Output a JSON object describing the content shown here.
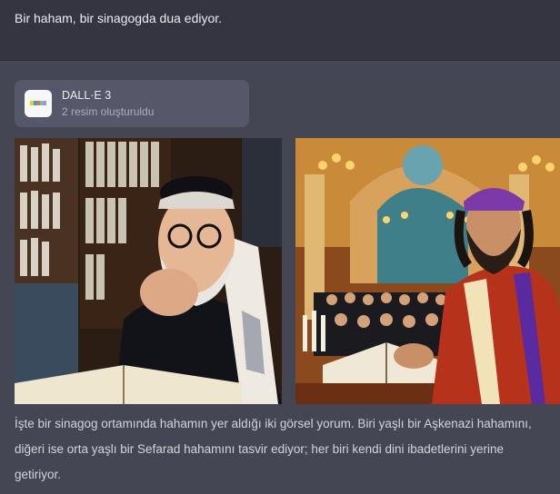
{
  "user_message": "Bir haham, bir sinagogda dua ediyor.",
  "dalle": {
    "title": "DALL·E 3",
    "subtitle": "2 resim oluşturuldu",
    "logo_colors": [
      "#ffcc00",
      "#00b2ff",
      "#ff5c5c",
      "#4ade80",
      "#a78bfa"
    ]
  },
  "images": [
    {
      "name": "ashkenazi-rabbi-image"
    },
    {
      "name": "sephardic-rabbi-image"
    }
  ],
  "caption": "İşte bir sinagog ortamında hahamın yer aldığı iki görsel yorum. Biri yaşlı bir Aşkenazi hahamını, diğeri ise orta yaşlı bir Sefarad hahamını tasvir ediyor; her biri kendi dini ibadetlerini yerine getiriyor."
}
